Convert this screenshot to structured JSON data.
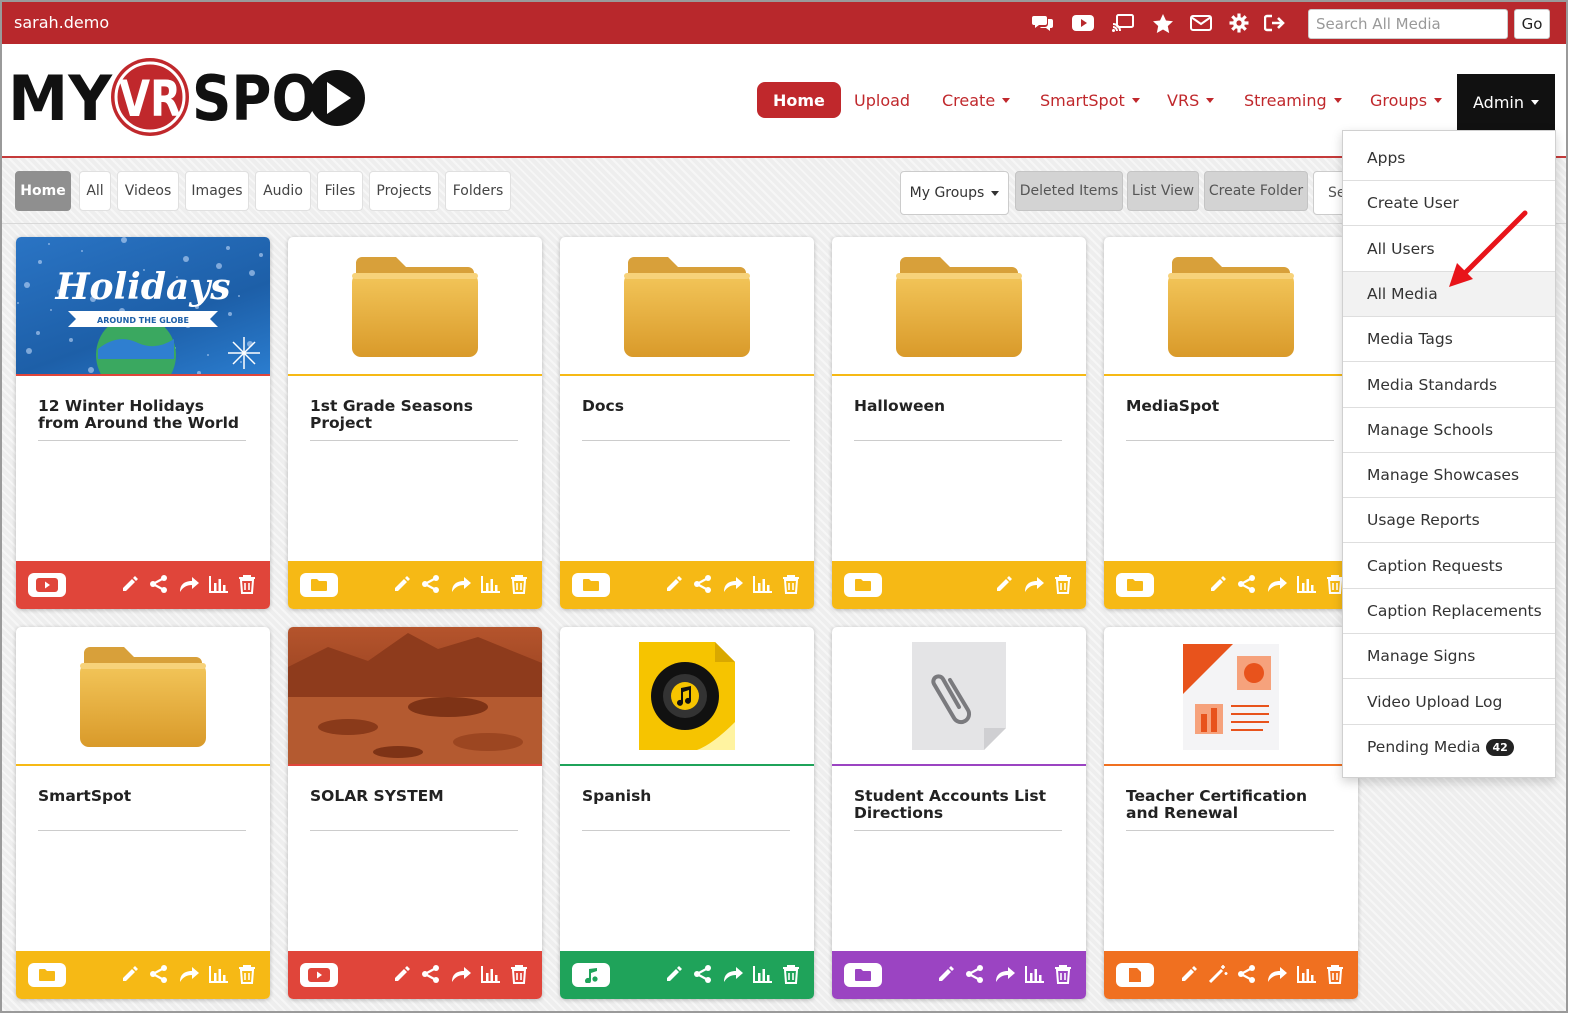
{
  "topbar": {
    "username": "sarah.demo",
    "icons": [
      "chat-icon",
      "youtube-icon",
      "cast-icon",
      "star-icon",
      "envelope-icon",
      "gear-icon",
      "sign-out-icon"
    ],
    "search_placeholder": "Search All Media",
    "go_label": "Go"
  },
  "nav": {
    "home": "Home",
    "upload": "Upload",
    "create": "Create",
    "smartspot": "SmartSpot",
    "vrs": "VRS",
    "streaming": "Streaming",
    "groups": "Groups",
    "admin": "Admin"
  },
  "tabs": {
    "home": "Home",
    "all": "All",
    "videos": "Videos",
    "images": "Images",
    "audio": "Audio",
    "files": "Files",
    "projects": "Projects",
    "folders": "Folders"
  },
  "toolbar": {
    "my_groups": "My Groups",
    "deleted_items": "Deleted Items",
    "list_view": "List View",
    "create_folder": "Create Folder",
    "se": "Se"
  },
  "cards": [
    {
      "title": "12 Winter Holidays from Around the World",
      "type": "video",
      "color": "#e0453a",
      "thumb_text": "Holidays",
      "thumb_sub": "AROUND THE GLOBE"
    },
    {
      "title": "1st Grade Seasons Project",
      "type": "folder",
      "color": "#f6b915"
    },
    {
      "title": "Docs",
      "type": "folder",
      "color": "#f6b915"
    },
    {
      "title": "Halloween",
      "type": "folder",
      "color": "#f6b915"
    },
    {
      "title": "MediaSpot",
      "type": "folder",
      "color": "#f6b915"
    },
    {
      "title": "SmartSpot",
      "type": "folder",
      "color": "#f6b915"
    },
    {
      "title": "SOLAR SYSTEM",
      "type": "video",
      "color": "#e0453a"
    },
    {
      "title": "Spanish",
      "type": "audio",
      "color": "#1fa35a"
    },
    {
      "title": "Student Accounts List Directions",
      "type": "file",
      "color": "#9b44c2"
    },
    {
      "title": "Teacher Certification and Renewal",
      "type": "project",
      "color": "#f07020"
    }
  ],
  "admin_menu": {
    "items": [
      "Apps",
      "Create User",
      "All Users",
      "All Media",
      "Media Tags",
      "Media Standards",
      "Manage Schools",
      "Manage Showcases",
      "Usage Reports",
      "Caption Requests",
      "Caption Replacements",
      "Manage Signs",
      "Video Upload Log",
      "Pending Media"
    ],
    "pending_count": "42",
    "highlighted": "All Media"
  },
  "colors": {
    "brand_red": "#b8282c",
    "folder_yellow": "#f6b915",
    "video_red": "#e0453a",
    "audio_green": "#1fa35a",
    "file_purple": "#9b44c2",
    "project_orange": "#f07020"
  }
}
